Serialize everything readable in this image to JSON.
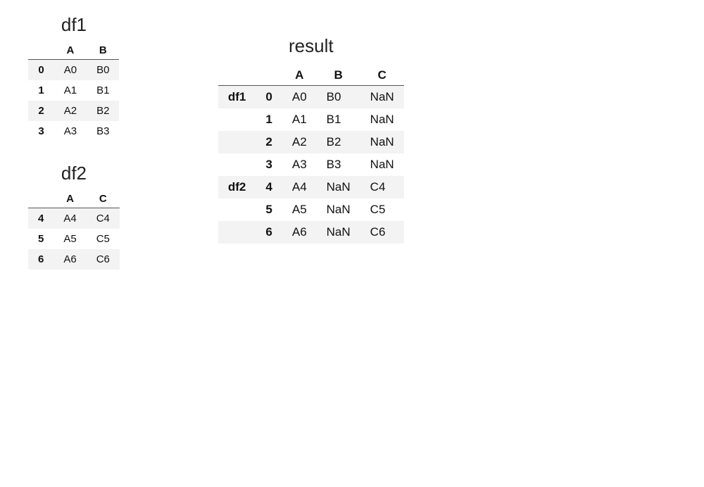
{
  "titles": {
    "df1": "df1",
    "df2": "df2",
    "result": "result"
  },
  "df1": {
    "columns": [
      "A",
      "B"
    ],
    "rows": [
      {
        "idx": "0",
        "vals": [
          "A0",
          "B0"
        ]
      },
      {
        "idx": "1",
        "vals": [
          "A1",
          "B1"
        ]
      },
      {
        "idx": "2",
        "vals": [
          "A2",
          "B2"
        ]
      },
      {
        "idx": "3",
        "vals": [
          "A3",
          "B3"
        ]
      }
    ]
  },
  "df2": {
    "columns": [
      "A",
      "C"
    ],
    "rows": [
      {
        "idx": "4",
        "vals": [
          "A4",
          "C4"
        ]
      },
      {
        "idx": "5",
        "vals": [
          "A5",
          "C5"
        ]
      },
      {
        "idx": "6",
        "vals": [
          "A6",
          "C6"
        ]
      }
    ]
  },
  "result": {
    "columns": [
      "A",
      "B",
      "C"
    ],
    "rows": [
      {
        "group": "df1",
        "idx": "0",
        "vals": [
          "A0",
          "B0",
          "NaN"
        ]
      },
      {
        "group": "",
        "idx": "1",
        "vals": [
          "A1",
          "B1",
          "NaN"
        ]
      },
      {
        "group": "",
        "idx": "2",
        "vals": [
          "A2",
          "B2",
          "NaN"
        ]
      },
      {
        "group": "",
        "idx": "3",
        "vals": [
          "A3",
          "B3",
          "NaN"
        ]
      },
      {
        "group": "df2",
        "idx": "4",
        "vals": [
          "A4",
          "NaN",
          "C4"
        ]
      },
      {
        "group": "",
        "idx": "5",
        "vals": [
          "A5",
          "NaN",
          "C5"
        ]
      },
      {
        "group": "",
        "idx": "6",
        "vals": [
          "A6",
          "NaN",
          "C6"
        ]
      }
    ]
  },
  "chart_data": {
    "type": "table",
    "tables": [
      {
        "name": "df1",
        "columns": [
          "A",
          "B"
        ],
        "index": [
          0,
          1,
          2,
          3
        ],
        "data": [
          [
            "A0",
            "B0"
          ],
          [
            "A1",
            "B1"
          ],
          [
            "A2",
            "B2"
          ],
          [
            "A3",
            "B3"
          ]
        ]
      },
      {
        "name": "df2",
        "columns": [
          "A",
          "C"
        ],
        "index": [
          4,
          5,
          6
        ],
        "data": [
          [
            "A4",
            "C4"
          ],
          [
            "A5",
            "C5"
          ],
          [
            "A6",
            "C6"
          ]
        ]
      },
      {
        "name": "result",
        "columns": [
          "A",
          "B",
          "C"
        ],
        "index": [
          [
            "df1",
            0
          ],
          [
            "df1",
            1
          ],
          [
            "df1",
            2
          ],
          [
            "df1",
            3
          ],
          [
            "df2",
            4
          ],
          [
            "df2",
            5
          ],
          [
            "df2",
            6
          ]
        ],
        "data": [
          [
            "A0",
            "B0",
            "NaN"
          ],
          [
            "A1",
            "B1",
            "NaN"
          ],
          [
            "A2",
            "B2",
            "NaN"
          ],
          [
            "A3",
            "B3",
            "NaN"
          ],
          [
            "A4",
            "NaN",
            "C4"
          ],
          [
            "A5",
            "NaN",
            "C5"
          ],
          [
            "A6",
            "NaN",
            "C6"
          ]
        ]
      }
    ]
  }
}
